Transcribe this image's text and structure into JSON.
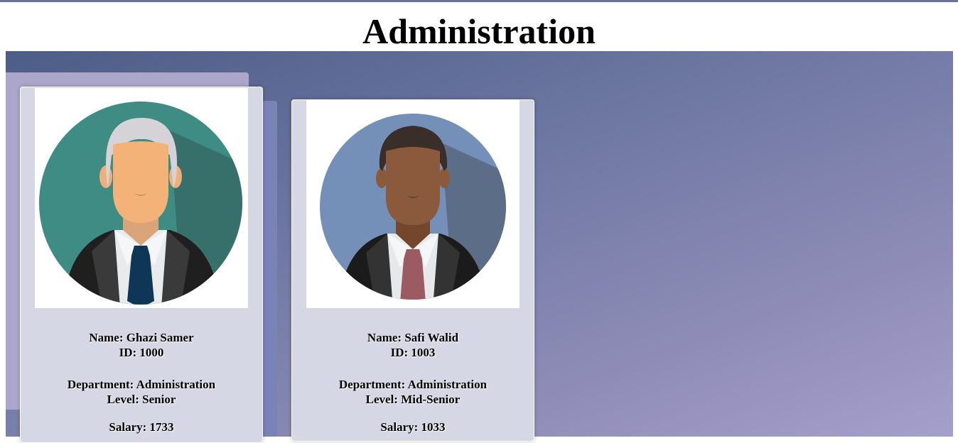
{
  "page": {
    "title": "Administration"
  },
  "employees": [
    {
      "name_line": "Name: Ghazi Samer",
      "id_line": "ID: 1000",
      "department_line": "Department: Administration",
      "level_line": "Level: Senior",
      "salary_line": "Salary: 1733",
      "avatar": "man-gray-hair-avatar-icon"
    },
    {
      "name_line": "Name: Safi Walid",
      "id_line": "ID: 1003",
      "department_line": "Department: Administration",
      "level_line": "Level: Mid-Senior",
      "salary_line": "Salary: 1033",
      "avatar": "man-dark-hair-avatar-icon"
    }
  ],
  "colors": {
    "card_bg": "#d5d8e4",
    "panel_gradient_start": "#4c5d88",
    "panel_gradient_end": "#a59fcc",
    "avatar1_bg": "#3e8c84",
    "avatar2_bg": "#7590b8"
  }
}
